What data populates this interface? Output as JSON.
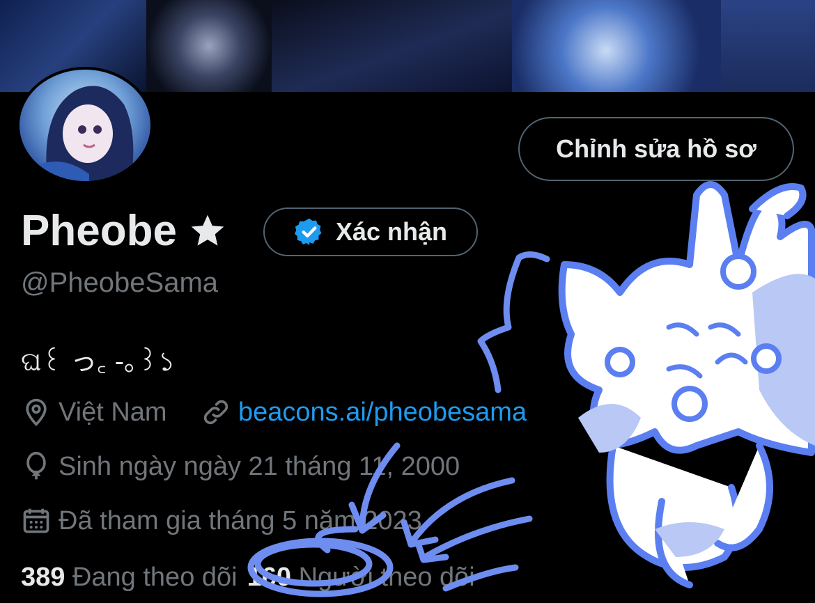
{
  "profile": {
    "edit_button": "Chỉnh sửa hồ sơ",
    "display_name": "Pheobe",
    "verify_label": "Xác nhận",
    "handle": "@PheobeSama",
    "bio": "ଘ꒰ っ꜀ -｡꒱১",
    "location": "Việt Nam",
    "website": "beacons.ai/pheobesama",
    "birthday": "Sinh ngày ngày 21 tháng 11, 2000",
    "joined": "Đã tham gia tháng 5 năm 2023",
    "following_count": "389",
    "following_label": "Đang theo dõi",
    "followers_count": "160",
    "followers_label": "Người theo dõi"
  },
  "icons": {
    "star": "star-icon",
    "verified": "verified-badge-icon",
    "location": "location-pin-icon",
    "link": "link-icon",
    "birthday": "balloon-icon",
    "calendar": "calendar-icon"
  },
  "colors": {
    "background": "#000000",
    "text": "#e7e9ea",
    "muted": "#71767b",
    "link": "#1d9bf0",
    "verified": "#1d9bf0",
    "doodle": "#6e8df0"
  }
}
